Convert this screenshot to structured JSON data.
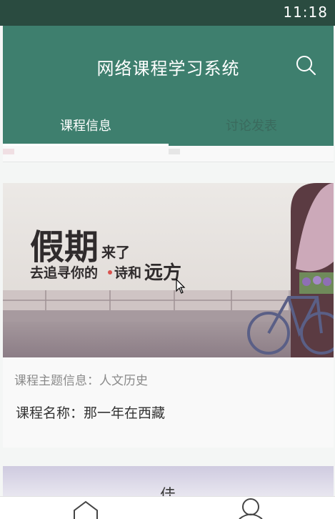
{
  "status_bar": {
    "time": "11:18"
  },
  "app_bar": {
    "title": "网络课程学习系统"
  },
  "tabs": [
    {
      "label": "课程信息",
      "selected": true
    },
    {
      "label": "讨论发表",
      "selected": false
    }
  ],
  "courses": [
    {
      "banner_text_big": "假期",
      "banner_text_small": "来了",
      "banner_line2_a": "去追寻你的",
      "banner_line2_b": "诗和",
      "banner_line2_c": "远方",
      "topic": "课程主题信息：人文历史",
      "name": "课程名称：那一年在西藏"
    },
    {
      "banner_partial_text": "佳"
    }
  ],
  "bottom_nav": [
    "home-icon",
    "user-icon"
  ]
}
